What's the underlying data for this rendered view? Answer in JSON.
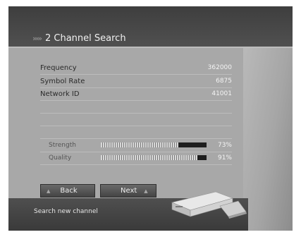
{
  "header": {
    "title": "2 Channel Search",
    "chevrons": "›››››"
  },
  "params": [
    {
      "label": "Frequency",
      "value": "362000"
    },
    {
      "label": "Symbol Rate",
      "value": "6875"
    },
    {
      "label": "Network ID",
      "value": "41001"
    }
  ],
  "signal": {
    "strength": {
      "label": "Strength",
      "percent_text": "73%",
      "level": 0.73
    },
    "quality": {
      "label": "Quality",
      "percent_text": "91%",
      "level": 0.91
    }
  },
  "buttons": {
    "back": {
      "label": "Back",
      "icon": "triangle-up-icon"
    },
    "next": {
      "label": "Next",
      "icon": "triangle-up-icon"
    }
  },
  "status": "Search new channel"
}
